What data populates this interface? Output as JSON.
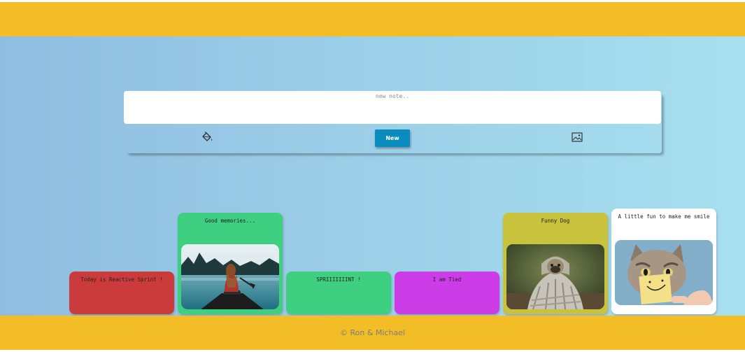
{
  "composer": {
    "placeholder": "new note..",
    "new_button_label": "New",
    "color_picker_icon": "paint-bucket-icon",
    "image_icon": "image-icon"
  },
  "notes": [
    {
      "text": "Today is Reactive Sprint !",
      "color": "#cc3b3b"
    },
    {
      "text": "Good memories...",
      "color": "#3ecf80",
      "image": "woman paddling a canoe on a mountain lake"
    },
    {
      "text": "SPRIIIIIIINT !",
      "color": "#3ecf80"
    },
    {
      "text": "I am Tied",
      "color": "#cc3de8"
    },
    {
      "text": "Funny Dog",
      "color": "#c9c23d",
      "image": "pug wrapped in a blanket"
    },
    {
      "text": "A little fun to make me smile",
      "color": "#ffffff",
      "image": "kitten holding a smiley-face sticky note"
    }
  ],
  "footer": {
    "text": "© Ron & Michael"
  },
  "colors": {
    "header_footer": "#f2bd27",
    "new_button": "#0a8cbf"
  }
}
